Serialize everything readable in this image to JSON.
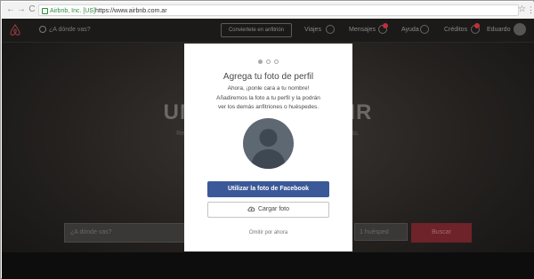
{
  "browser": {
    "secure_label": "Airbnb, Inc. [US]",
    "separator": "|",
    "url": "https://www.airbnb.com.ar",
    "back": "←",
    "forward": "→",
    "reload": "C",
    "star": "☆",
    "menu": "⋮"
  },
  "topbar": {
    "search_placeholder": "¿A dónde vas?",
    "host_button": "Conviertete en anfitrión",
    "links": [
      "Viajes",
      "Mensajes",
      "Ayuda",
      "Créditos",
      "Eduardo"
    ]
  },
  "hero": {
    "title": "UN LUGAR                                   E VIVIR",
    "subtitle": "Reserva alojamientos de anfitriones                                                          udad como un habitante más."
  },
  "searchbar": {
    "placeholder": "¿A dónde vas?",
    "guests": "1 huésped",
    "button": "Buscar"
  },
  "modal": {
    "title": "Agrega tu foto de perfil",
    "body_lines": [
      "Ahora, ¡ponle cara a tu nombre!",
      "Añadiremos la foto a tu perfil y la podrán",
      "ver los demás anfitriones o huéspedes."
    ],
    "facebook_button": "Utilizar la foto de Facebook",
    "upload_button": "Cargar foto",
    "skip_link": "Omitir por ahora",
    "step_current": 1,
    "step_total": 3
  },
  "colors": {
    "facebook_blue": "#3b5998",
    "airbnb_red": "#ff5a5f",
    "secure_green": "#2e8b3e"
  }
}
